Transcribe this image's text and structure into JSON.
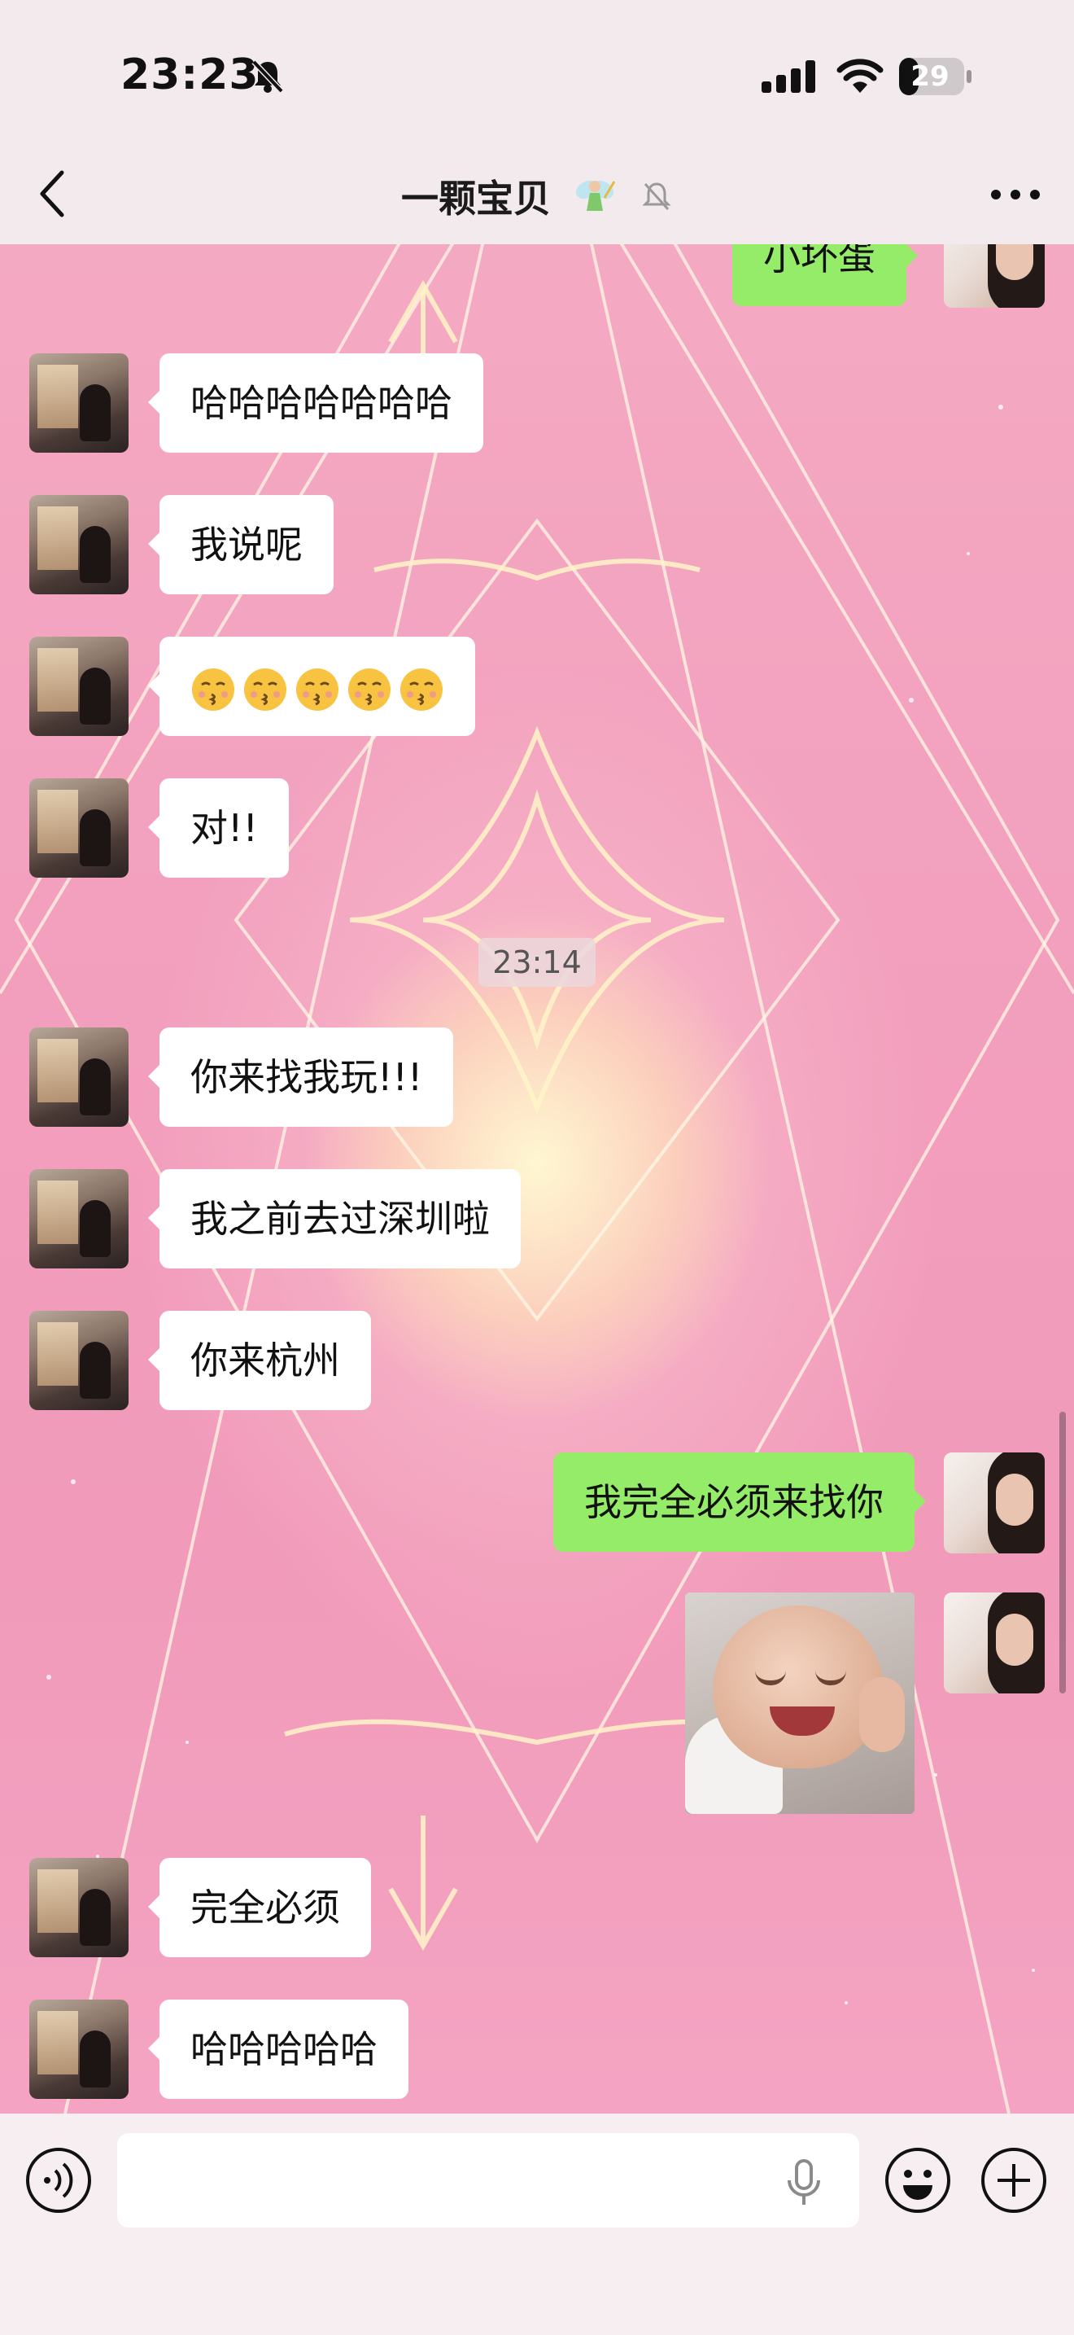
{
  "status_bar": {
    "time": "23:23",
    "battery": "29"
  },
  "header": {
    "title": "一颗宝贝"
  },
  "messages": [
    {
      "side": "right",
      "text": "小坏蛋"
    },
    {
      "side": "left",
      "text": "哈哈哈哈哈哈哈"
    },
    {
      "side": "left",
      "text": "我说呢"
    },
    {
      "side": "left",
      "text": "",
      "emoji_count": 5,
      "emoji": "kissing-face"
    },
    {
      "side": "left",
      "text": "对!!"
    },
    {
      "timestamp": "23:14"
    },
    {
      "side": "left",
      "text": "你来找我玩!!!"
    },
    {
      "side": "left",
      "text": "我之前去过深圳啦"
    },
    {
      "side": "left",
      "text": "你来杭州"
    },
    {
      "side": "right",
      "text": "我完全必须来找你"
    },
    {
      "side": "right",
      "sticker": "laughing-baby"
    },
    {
      "side": "left",
      "text": "完全必须"
    },
    {
      "side": "left",
      "text": "哈哈哈哈哈"
    }
  ],
  "colors": {
    "sent_bubble": "#95ec69",
    "received_bubble": "#ffffff",
    "chat_background": "#f19aba"
  },
  "icons": {
    "status": [
      "bell-off-icon",
      "signal-icon",
      "wifi-icon",
      "battery-icon"
    ],
    "header": [
      "back-icon",
      "fairy-icon",
      "mute-icon",
      "more-icon"
    ],
    "input": [
      "voice-icon",
      "mic-icon",
      "emoji-icon",
      "plus-icon"
    ]
  }
}
